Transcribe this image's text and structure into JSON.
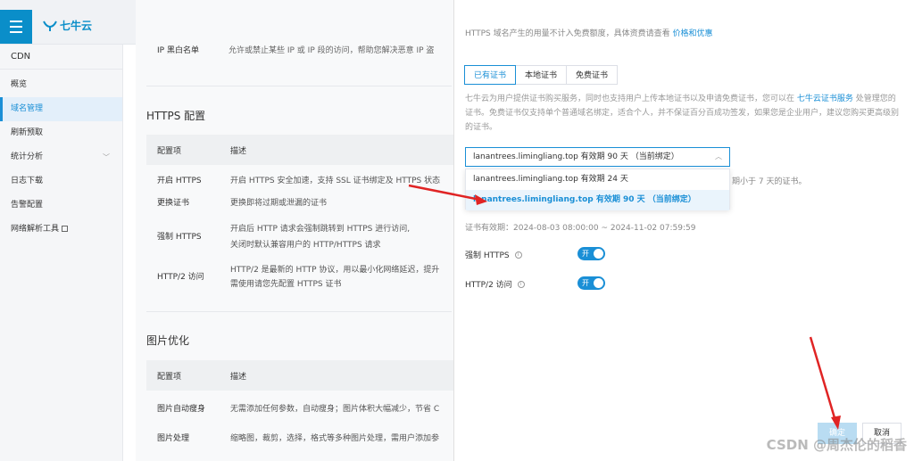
{
  "brand": {
    "logo_text": "七牛云"
  },
  "sidebar": {
    "title": "CDN",
    "items": [
      {
        "label": "概览"
      },
      {
        "label": "域名管理"
      },
      {
        "label": "刷新预取"
      },
      {
        "label": "统计分析"
      },
      {
        "label": "日志下载"
      },
      {
        "label": "告警配置"
      },
      {
        "label": "网络解析工具"
      }
    ]
  },
  "main": {
    "blacklist": {
      "label": "IP 黑白名单",
      "desc": "允许或禁止某些 IP 或 IP 段的访问，帮助您解决恶意 IP 盗"
    },
    "https_section": {
      "title": "HTTPS 配置",
      "col_item": "配置项",
      "col_desc": "描述",
      "rows": [
        {
          "key": "开启 HTTPS",
          "desc": "开启 HTTPS 安全加速，支持 SSL 证书绑定及 HTTPS 状态"
        },
        {
          "key": "更换证书",
          "desc": "更换即将过期或泄漏的证书"
        },
        {
          "key": "强制 HTTPS",
          "desc_line1": "开启后 HTTP 请求会强制跳转到 HTTPS 进行访问,",
          "desc_line2": "关闭时默认兼容用户的 HTTP/HTTPS 请求"
        },
        {
          "key": "HTTP/2 访问",
          "desc_line1": "HTTP/2 是最新的 HTTP 协议，用以最小化网络延迟，提升",
          "desc_line2": "需使用请您先配置 HTTPS 证书"
        }
      ]
    },
    "image_section": {
      "title": "图片优化",
      "col_item": "配置项",
      "col_desc": "描述",
      "rows": [
        {
          "key": "图片自动瘦身",
          "desc": "无需添加任何参数，自动瘦身；图片体积大幅减少，节省 C"
        },
        {
          "key": "图片处理",
          "desc": "缩略图，裁剪，选择，格式等多种图片处理，需用户添加参"
        }
      ]
    }
  },
  "drawer": {
    "note_prefix": "HTTPS 域名产生的用量不计入免费额度，具体资费请查看 ",
    "note_link": "价格和优惠",
    "tabs": [
      {
        "label": "已有证书",
        "active": true
      },
      {
        "label": "本地证书",
        "active": false
      },
      {
        "label": "免费证书",
        "active": false
      }
    ],
    "desc_part1": "七牛云为用户提供证书购买服务，同时也支持用户上传本地证书以及申请免费证书，您可以在 ",
    "desc_link": "七牛云证书服务",
    "desc_part2": " 处管理您的证书。免费证书仅支持单个普通域名绑定，适合个人，并不保证百分百成功签发，如果您是企业用户，建议您购买更高级别的证书。",
    "select_value": "lanantrees.limingliang.top 有效期 90 天 （当前绑定）",
    "options": [
      {
        "label": "lanantrees.limingliang.top 有效期 24 天",
        "selected": false
      },
      {
        "label": "lanantrees.limingliang.top 有效期 90 天 （当前绑定）",
        "selected": true
      }
    ],
    "hint_tail": "期小于 7 天的证书。",
    "validity": "证书有效期：2024-08-03 08:00:00 ~ 2024-11-02 07:59:59",
    "force_https_label": "强制 HTTPS",
    "http2_label": "HTTP/2 访问",
    "switch_on_text": "开",
    "ok_label": "确定",
    "cancel_label": "取消"
  },
  "watermark": "CSDN @周杰伦的稻香",
  "colors": {
    "accent": "#1a8fd6",
    "sidebar_bg": "#f5f6f8",
    "arrow": "#e02424"
  }
}
